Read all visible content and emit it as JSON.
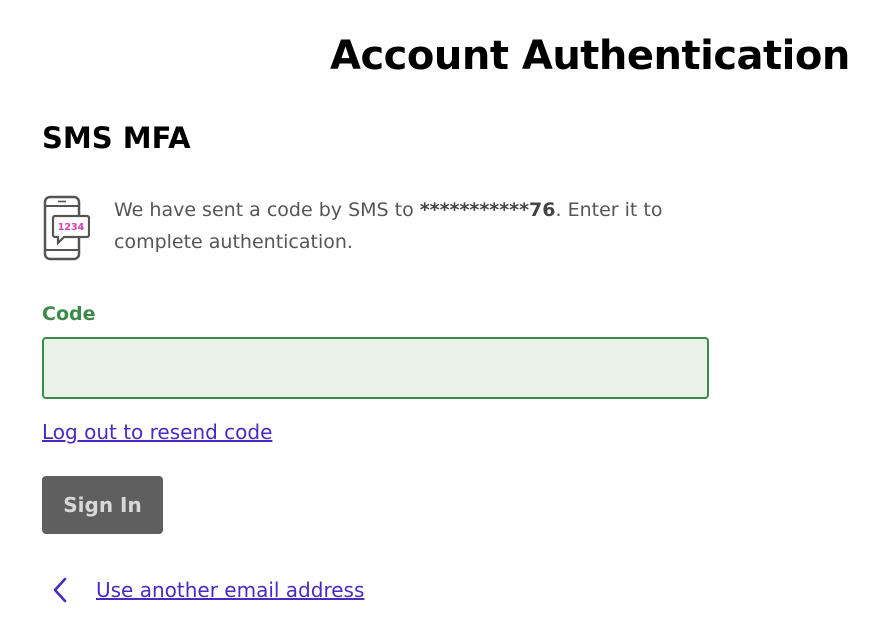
{
  "header": {
    "title": "Account Authentication"
  },
  "mfa": {
    "section_title": "SMS MFA",
    "icon": "phone-sms-icon",
    "icon_code_text": "1234",
    "message_prefix": "We have sent a code by SMS to ",
    "masked_phone": "***********76",
    "message_suffix": ". Enter it to complete authentication."
  },
  "form": {
    "code_label": "Code",
    "code_value": "",
    "resend_link": "Log out to resend code",
    "sign_in_label": "Sign In"
  },
  "footer": {
    "back_icon": "chevron-left-icon",
    "back_link": "Use another email address"
  },
  "colors": {
    "accent_green": "#3b8a4a",
    "input_bg": "#e9f3ea",
    "link_purple": "#4a2bbf",
    "icon_pink": "#d63fb8",
    "button_bg": "#5f5f5f"
  }
}
